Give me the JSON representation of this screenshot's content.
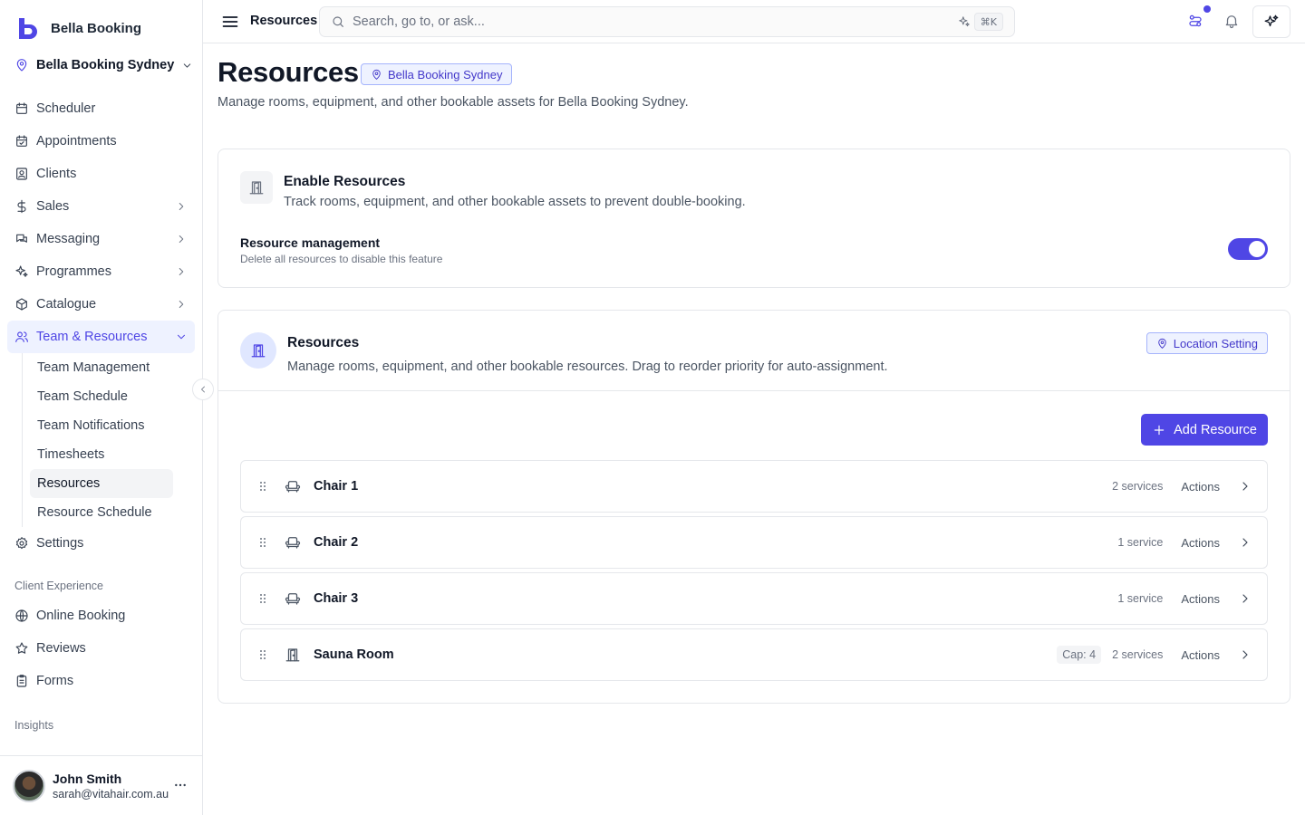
{
  "app": {
    "brand_name": "Bella Booking",
    "accent_color": "#4f46e5"
  },
  "location": {
    "name": "Bella Booking Sydney",
    "icon": "map-pin-icon"
  },
  "sidebar": {
    "items": [
      {
        "label": "Scheduler",
        "icon": "calendar-icon"
      },
      {
        "label": "Appointments",
        "icon": "calendar-check-icon"
      },
      {
        "label": "Clients",
        "icon": "contact-icon"
      },
      {
        "label": "Sales",
        "icon": "dollar-icon",
        "expandable": true
      },
      {
        "label": "Messaging",
        "icon": "chat-icon",
        "expandable": true
      },
      {
        "label": "Programmes",
        "icon": "sparkle-icon",
        "expandable": true
      },
      {
        "label": "Catalogue",
        "icon": "box-icon",
        "expandable": true
      },
      {
        "label": "Team & Resources",
        "icon": "users-icon",
        "expanded": true,
        "active": true
      }
    ],
    "sub_items": [
      {
        "label": "Team Management"
      },
      {
        "label": "Team Schedule"
      },
      {
        "label": "Team Notifications"
      },
      {
        "label": "Timesheets"
      },
      {
        "label": "Resources",
        "active": true
      },
      {
        "label": "Resource Schedule"
      }
    ],
    "settings": {
      "label": "Settings",
      "icon": "gear-icon"
    },
    "client_experience": {
      "label": "Client Experience",
      "items": [
        {
          "label": "Online Booking",
          "icon": "globe-icon"
        },
        {
          "label": "Reviews",
          "icon": "star-icon"
        },
        {
          "label": "Forms",
          "icon": "clipboard-icon"
        }
      ]
    },
    "insights_label": "Insights"
  },
  "user": {
    "name": "John Smith",
    "email": "sarah@vitahair.com.au"
  },
  "topbar": {
    "breadcrumb": "Resources",
    "search_placeholder": "Search, go to, or ask...",
    "shortcut": "⌘K"
  },
  "page": {
    "title": "Resources",
    "location_badge": "Bella Booking Sydney",
    "subtitle": "Manage rooms, equipment, and other bookable assets for Bella Booking Sydney."
  },
  "enable_card": {
    "title": "Enable Resources",
    "description": "Track rooms, equipment, and other bookable assets to prevent double-booking.",
    "setting_label": "Resource management",
    "setting_help": "Delete all resources to disable this feature",
    "enabled": true
  },
  "resources_card": {
    "title": "Resources",
    "description": "Manage rooms, equipment, and other bookable resources. Drag to reorder priority for auto-assignment.",
    "location_setting_label": "Location Setting",
    "add_button_label": "Add Resource",
    "actions_label": "Actions",
    "items": [
      {
        "name": "Chair 1",
        "icon": "armchair-icon",
        "services": "2 services"
      },
      {
        "name": "Chair 2",
        "icon": "armchair-icon",
        "services": "1 service"
      },
      {
        "name": "Chair 3",
        "icon": "armchair-icon",
        "services": "1 service"
      },
      {
        "name": "Sauna Room",
        "icon": "door-icon",
        "capacity": "Cap: 4",
        "services": "2 services"
      }
    ]
  }
}
